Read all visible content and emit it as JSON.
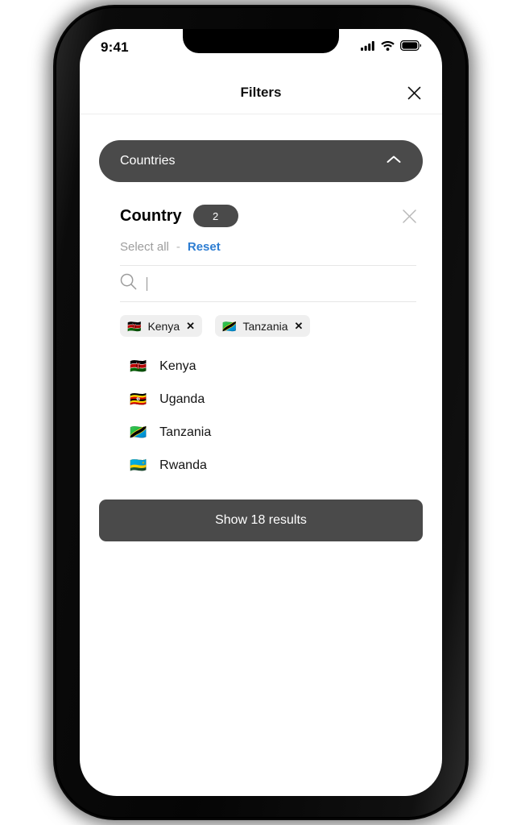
{
  "status_bar": {
    "time": "9:41",
    "icons": [
      "signal-icon",
      "wifi-icon",
      "battery-icon"
    ]
  },
  "sheet": {
    "title": "Filters",
    "close_icon": "close-icon"
  },
  "accordion": {
    "label": "Countries",
    "chevron_icon": "chevron-up-icon",
    "expanded": true,
    "background": "#4a4a4a"
  },
  "country_section": {
    "title": "Country",
    "badge_count": "2",
    "clear_icon": "close-icon",
    "select_all_label": "Select all",
    "separator": "-",
    "reset_label": "Reset",
    "reset_color": "#2d7dd2",
    "search": {
      "icon": "search-icon",
      "value": "",
      "placeholder": ""
    },
    "selected_chips": [
      {
        "flag": "🇰🇪",
        "label": "Kenya",
        "remove_icon": "close-icon"
      },
      {
        "flag": "🇹🇿",
        "label": "Tanzania",
        "remove_icon": "close-icon"
      }
    ],
    "options": [
      {
        "flag": "🇰🇪",
        "label": "Kenya"
      },
      {
        "flag": "🇺🇬",
        "label": "Uganda"
      },
      {
        "flag": "🇹🇿",
        "label": "Tanzania"
      },
      {
        "flag": "🇷🇼",
        "label": "Rwanda"
      }
    ]
  },
  "footer": {
    "show_results_label": "Show 18 results"
  }
}
